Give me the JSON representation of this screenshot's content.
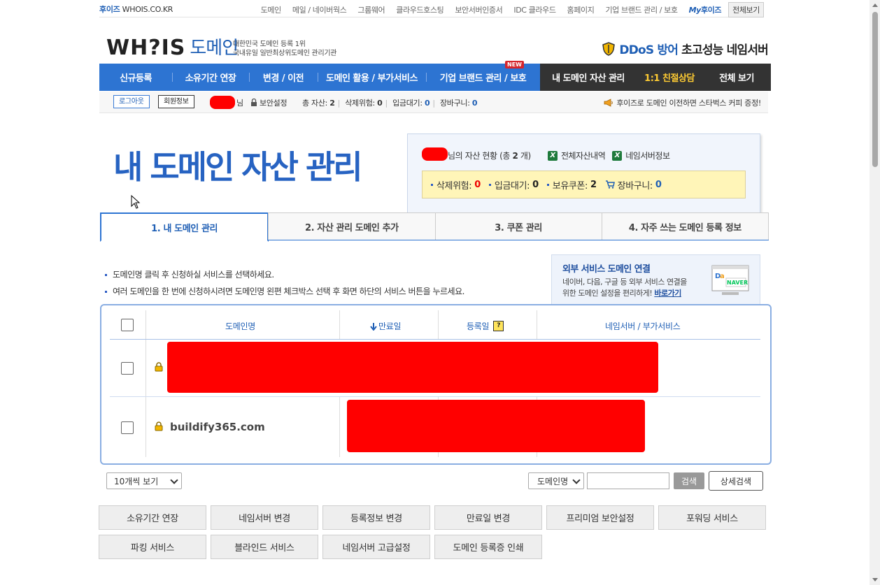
{
  "top": {
    "brand_kr": "후이즈",
    "brand_en": "WHOIS.CO.KR",
    "links": [
      "도메인",
      "메일 / 네이버웍스",
      "그룹웨어",
      "클라우드호스팅",
      "보안서버인증서",
      "IDC 클라우드",
      "홈페이지",
      "기업 브랜드 관리 / 보호"
    ],
    "my_label_a": "My",
    "my_label_b": "후이즈",
    "view_all": "전체보기"
  },
  "logo": {
    "whois": "WH?IS",
    "domain": "도메인",
    "sub1": "대한민국 도메인 등록 1위",
    "sub2": "국내유일 일반최상위도메인 관리기관"
  },
  "ad": {
    "ddos": "DDoS 방어",
    "rest": "초고성능 네임서버"
  },
  "nav": {
    "items": [
      "신규등록",
      "소유기간 연장",
      "변경 / 이전",
      "도메인 활용 / 부가서비스",
      "기업 브랜드 관리 / 보호"
    ],
    "new_badge": "NEW",
    "dark_items": [
      "내 도메인 자산 관리",
      "1:1 친절상담",
      "전체 보기"
    ]
  },
  "userbar": {
    "logout": "로그아웃",
    "member_info": "회원정보",
    "nim": "님",
    "security": "보안설정",
    "total_assets_label": "총 자산:",
    "total_assets": "2",
    "delete_risk_label": "삭제위험:",
    "delete_risk": "0",
    "pending_label": "입금대기:",
    "pending": "0",
    "cart_label": "장바구니:",
    "cart": "0",
    "promo": "후이즈로 도메인 이전하면 스타벅스 커피 증정!"
  },
  "page_title": "내 도메인 자산 관리",
  "asset": {
    "title_suffix": "님의 자산 현황 (총",
    "count": "2",
    "unit": "개)",
    "export_all": "전체자산내역",
    "ns_info": "네임서버정보",
    "xls_letter": "X",
    "stats": {
      "delete_risk_label": "삭제위험:",
      "delete_risk": "0",
      "pending_label": "입금대기:",
      "pending": "0",
      "coupons_label": "보유쿠폰:",
      "coupons": "2",
      "cart_label": "장바구니:",
      "cart": "0"
    }
  },
  "tabs": [
    "1. 내 도메인 관리",
    "2. 자산 관리 도메인 추가",
    "3. 쿠폰 관리",
    "4. 자주 쓰는 도메인 등록 정보"
  ],
  "info": [
    "도메인명 클릭 후 신청하실 서비스를 선택하세요.",
    "여러 도메인을 한 번에 신청하시려면 도메인명 왼편 체크박스 선택 후 화면 하단의 서비스 버튼을 누르세요."
  ],
  "external": {
    "title": "외부 서비스 도메인 연결",
    "desc1": "네이버, 다음, 구글 등 외부 서비스 연결을",
    "desc2": "위한 도메인 설정을 편리하게!",
    "link": "바로가기",
    "naver": "NAVER"
  },
  "table": {
    "headers": {
      "domain": "도메인명",
      "expiry": "만료일",
      "registered": "등록일",
      "help": "?",
      "ns": "네임서버 / 부가서비스"
    },
    "rows": [
      {
        "domain": ""
      },
      {
        "domain": "buildify365.com"
      }
    ]
  },
  "controls": {
    "per_page": "10개씩 보기",
    "search_field": "도메인명",
    "search_value": "",
    "search_btn": "검색",
    "advanced": "상세검색"
  },
  "actions": [
    "소유기간 연장",
    "네임서버 변경",
    "등록정보 변경",
    "만료일 변경",
    "프리미엄 보안설정",
    "포워딩 서비스",
    "파킹 서비스",
    "블라인드 서비스",
    "네임서버 고급설정",
    "도메인 등록증 인쇄"
  ],
  "colors": {
    "brand_blue": "#2d74d2",
    "title_blue": "#2763c2",
    "nav_dark": "#333333",
    "accent_yellow": "#ffcc33",
    "redaction": "#ff0000",
    "alert_red": "#ee0000"
  }
}
